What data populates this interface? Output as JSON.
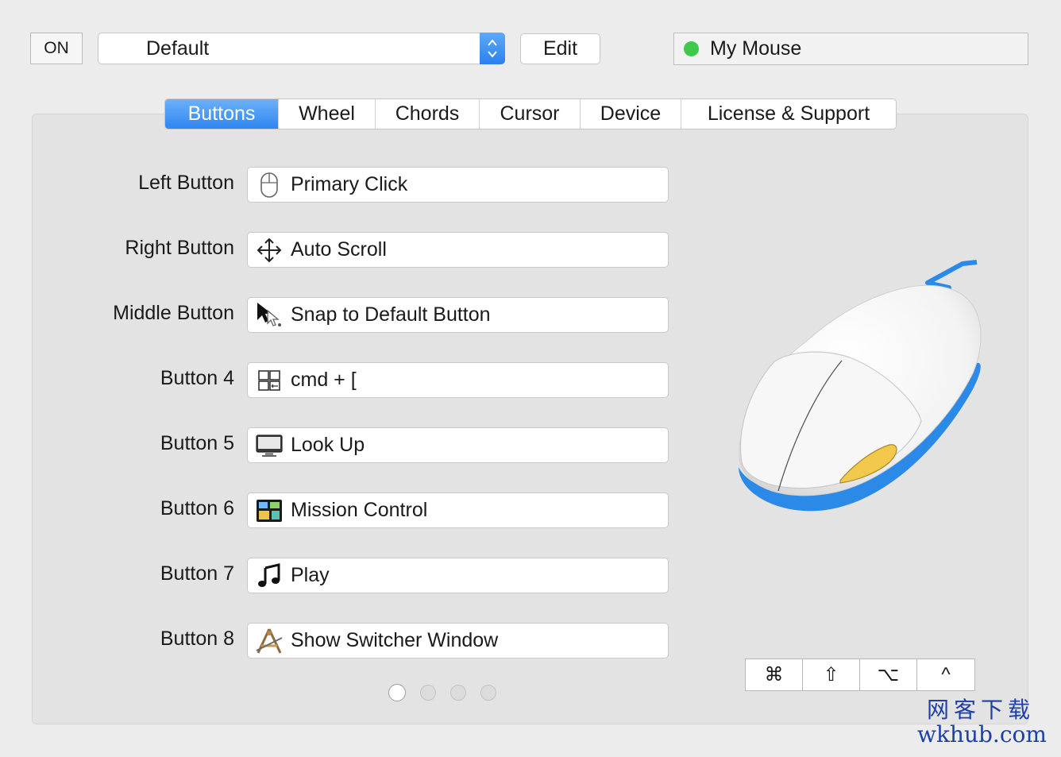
{
  "toolbar": {
    "on_label": "ON",
    "preset_value": "Default",
    "edit_label": "Edit",
    "device_name": "My Mouse",
    "device_status_color": "#3fc94a"
  },
  "tabs": [
    {
      "label": "Buttons",
      "active": true
    },
    {
      "label": "Wheel",
      "active": false
    },
    {
      "label": "Chords",
      "active": false
    },
    {
      "label": "Cursor",
      "active": false
    },
    {
      "label": "Device",
      "active": false
    },
    {
      "label": "License & Support",
      "active": false
    }
  ],
  "buttons": [
    {
      "label": "Left Button",
      "action": "Primary Click",
      "icon": "mouse-icon"
    },
    {
      "label": "Right Button",
      "action": "Auto Scroll",
      "icon": "move-arrows-icon"
    },
    {
      "label": "Middle Button",
      "action": "Snap to Default Button",
      "icon": "cursor-snap-icon"
    },
    {
      "label": "Button 4",
      "action": "cmd + [",
      "icon": "keyboard-shortcut-icon"
    },
    {
      "label": "Button 5",
      "action": "Look Up",
      "icon": "display-icon"
    },
    {
      "label": "Button 6",
      "action": "Mission Control",
      "icon": "mission-control-icon"
    },
    {
      "label": "Button 7",
      "action": "Play",
      "icon": "music-note-icon"
    },
    {
      "label": "Button 8",
      "action": "Show Switcher Window",
      "icon": "app-switcher-icon"
    }
  ],
  "pager": {
    "pages": 4,
    "current": 1
  },
  "modifiers": [
    {
      "symbol": "⌘",
      "name": "command"
    },
    {
      "symbol": "⇧",
      "name": "shift"
    },
    {
      "symbol": "⌥",
      "name": "option"
    },
    {
      "symbol": "^",
      "name": "control"
    }
  ],
  "watermark": {
    "cn": "网客下载",
    "en": "wkhub.com"
  },
  "colors": {
    "accent": "#2f86ef",
    "mouse_trim": "#2b8ae8",
    "highlight_button": "#f2c94c"
  }
}
